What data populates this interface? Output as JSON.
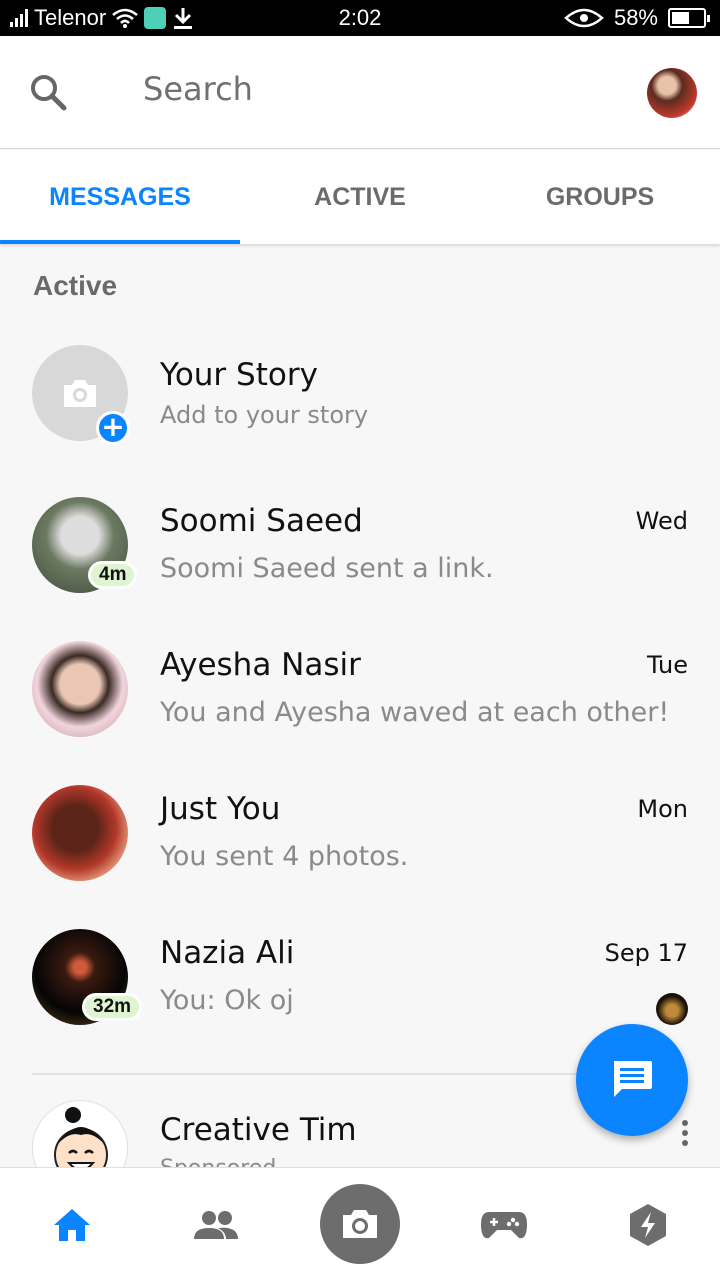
{
  "status_bar": {
    "carrier": "Telenor",
    "time": "2:02",
    "battery": "58%",
    "battery_level": 0.58,
    "icons": [
      "signal-icon",
      "wifi-icon",
      "app-notification-icon",
      "download-icon",
      "eye-icon",
      "battery-icon"
    ]
  },
  "header": {
    "search_placeholder": "Search"
  },
  "tabs": [
    {
      "label": "MESSAGES",
      "active": true
    },
    {
      "label": "ACTIVE",
      "active": false
    },
    {
      "label": "GROUPS",
      "active": false
    }
  ],
  "section_title": "Active",
  "story": {
    "title": "Your Story",
    "subtitle": "Add to your story"
  },
  "conversations": [
    {
      "name": "Soomi Saeed",
      "snippet": "Soomi Saeed sent a link.",
      "time": "Wed",
      "badge": "4m"
    },
    {
      "name": "Ayesha Nasir",
      "snippet": "You and Ayesha waved at each other!",
      "time": "Tue",
      "badge": ""
    },
    {
      "name": "Just You",
      "snippet": "You sent 4 photos.",
      "time": "Mon",
      "badge": ""
    },
    {
      "name": "Nazia Ali",
      "snippet": "You: Ok oj",
      "time": "Sep 17",
      "badge": "32m"
    }
  ],
  "sponsored": {
    "name": "Creative Tim",
    "subtitle": "Sponsored"
  },
  "colors": {
    "accent": "#0a84ff",
    "active_badge": "#dff5d2"
  },
  "bottom_nav": [
    "home-icon",
    "people-icon",
    "camera-icon",
    "games-icon",
    "discover-icon"
  ]
}
